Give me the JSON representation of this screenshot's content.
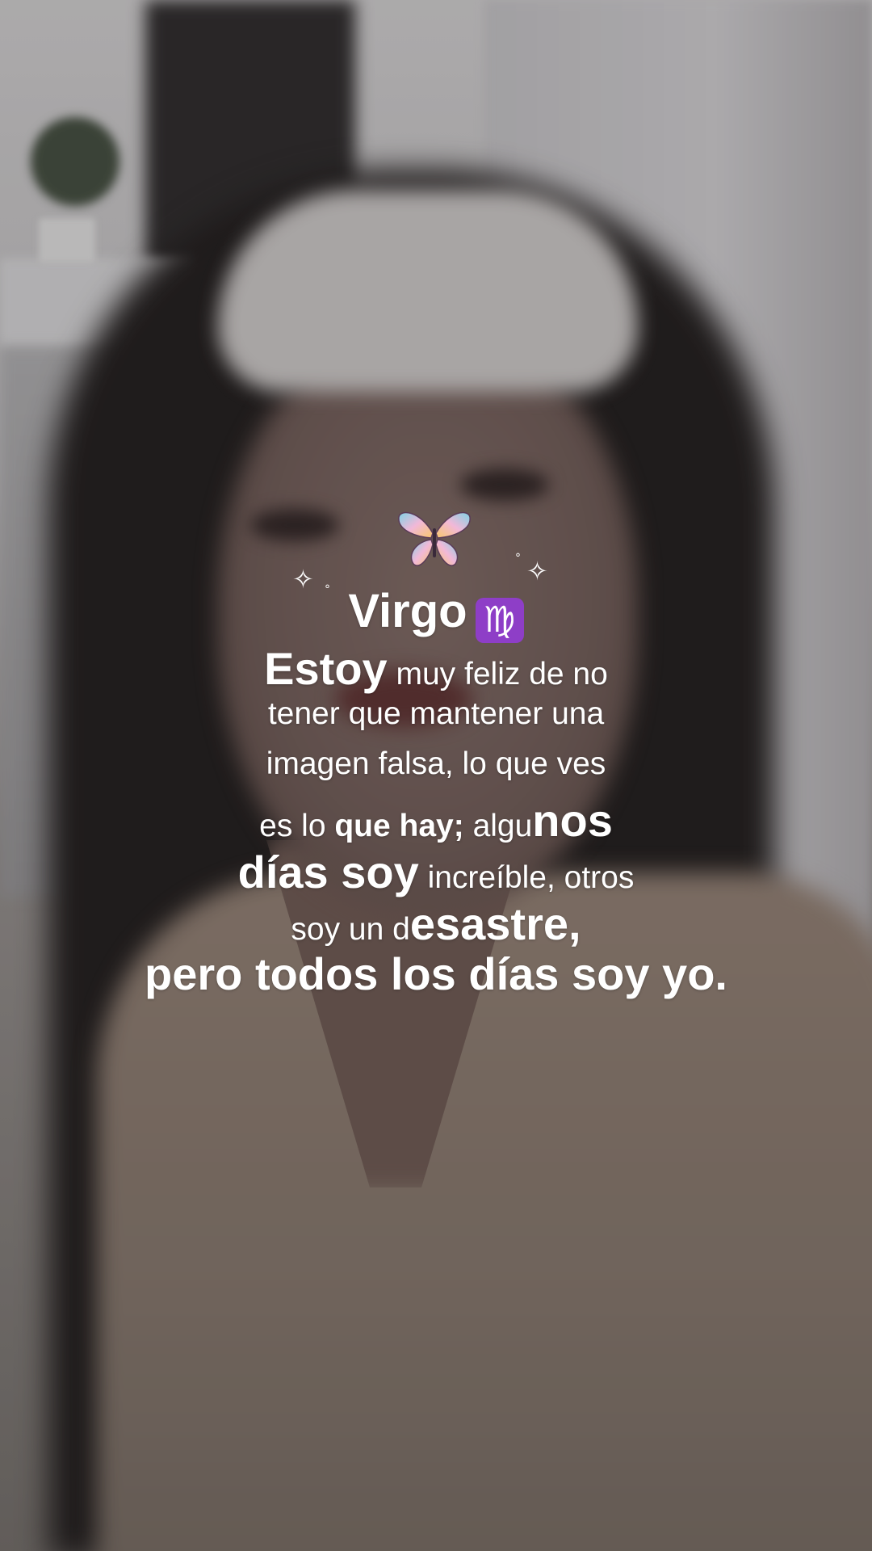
{
  "title": "Virgo",
  "zodiac_symbol": "♍",
  "icons": {
    "butterfly": "butterfly-icon",
    "sparkle": "sparkle-icon"
  },
  "sparkle_glyph": "✧",
  "dot_glyph": "°",
  "quote": {
    "line1": {
      "bold": "Estoy",
      "regular": " muy feliz de no"
    },
    "line2": "tener que mantener una",
    "line3": "imagen falsa, lo que ves",
    "line4": {
      "regular": "es lo ",
      "bold": "que hay; ",
      "regular2": "algu",
      "big": "nos"
    },
    "line5": {
      "big": "días soy",
      "regular": " increíble, otros"
    },
    "line6": {
      "regular": "soy un d",
      "big": "esastre,"
    },
    "line7": "pero todos los días soy yo."
  },
  "colors": {
    "text": "#ffffff",
    "virgo_badge": "#8e3ec7"
  }
}
